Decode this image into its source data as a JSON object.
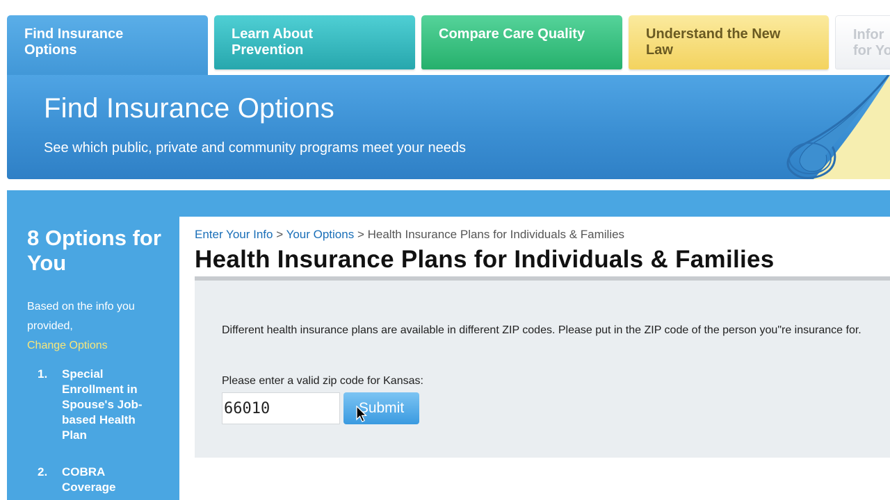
{
  "tabs": [
    {
      "label_line1": "Find Insurance",
      "label_line2": "Options"
    },
    {
      "label_line1": "Learn About",
      "label_line2": "Prevention"
    },
    {
      "label_line1": "Compare Care Quality",
      "label_line2": ""
    },
    {
      "label_line1": "Understand the New",
      "label_line2": "Law"
    },
    {
      "label_line1": "Infor",
      "label_line2": "for Yo"
    }
  ],
  "banner": {
    "title": "Find Insurance Options",
    "subtitle": "See which public, private and community programs meet your needs"
  },
  "sidebar": {
    "title": "8 Options for You",
    "intro": "Based on the info you provided,",
    "change_link": "Change Options",
    "options": [
      {
        "num": "1.",
        "label": "Special Enrollment in Spouse's Job-based Health Plan"
      },
      {
        "num": "2.",
        "label": "COBRA Coverage"
      }
    ]
  },
  "breadcrumb": {
    "step1": "Enter Your Info",
    "sep1": " > ",
    "step2": "Your Options",
    "sep2": " > ",
    "current": "Health Insurance Plans for Individuals & Families"
  },
  "main": {
    "title": "Health Insurance Plans for Individuals & Families",
    "description": "Different health insurance plans are available in different ZIP codes. Please put in the ZIP code of the person you\"re insurance for.",
    "zip_label": "Please enter a valid zip code for Kansas:",
    "zip_value": "66010",
    "submit_label": "Submit"
  },
  "colors": {
    "primary_blue": "#4aa6e2",
    "link_blue": "#1a6fb8",
    "link_yellow": "#f9e77a"
  }
}
